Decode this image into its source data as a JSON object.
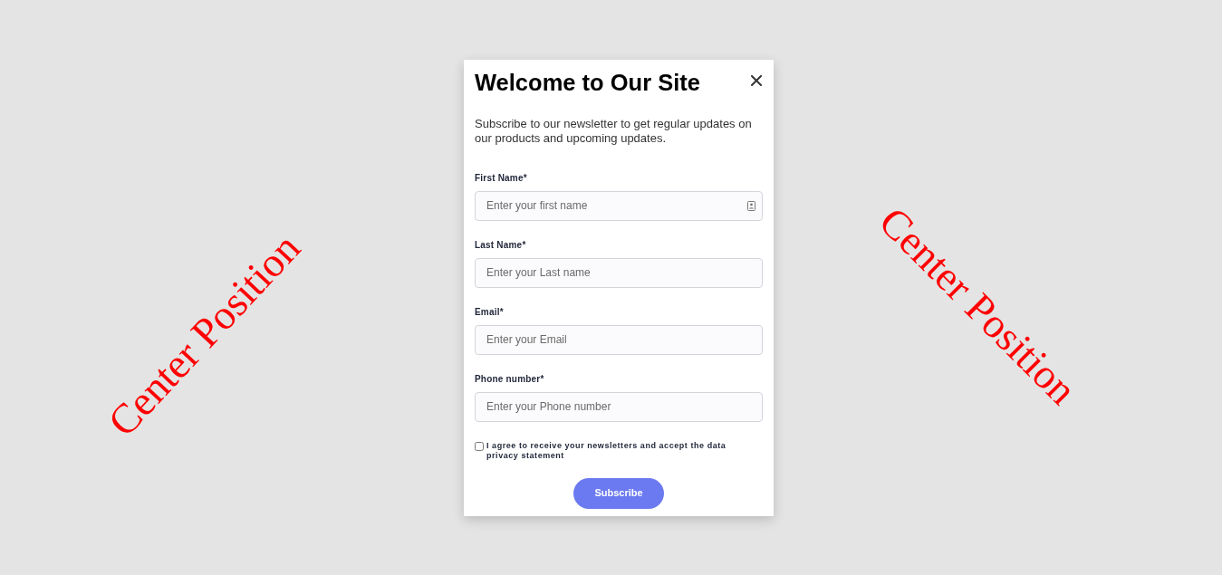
{
  "side_labels": [
    "Center Position",
    "Center Position"
  ],
  "modal": {
    "title": "Welcome to Our Site",
    "description": "Subscribe to our newsletter to get regular updates on our products and upcoming updates.",
    "fields": [
      {
        "label": "First Name*",
        "placeholder": "Enter your first name",
        "contact_icon": true
      },
      {
        "label": "Last Name*",
        "placeholder": "Enter your Last name"
      },
      {
        "label": "Email*",
        "placeholder": "Enter your Email"
      },
      {
        "label": "Phone number*",
        "placeholder": "Enter your Phone number"
      }
    ],
    "consent": {
      "text": "I agree to receive your newsletters and accept the data privacy statement",
      "checked": false
    },
    "submit": "Subscribe"
  }
}
